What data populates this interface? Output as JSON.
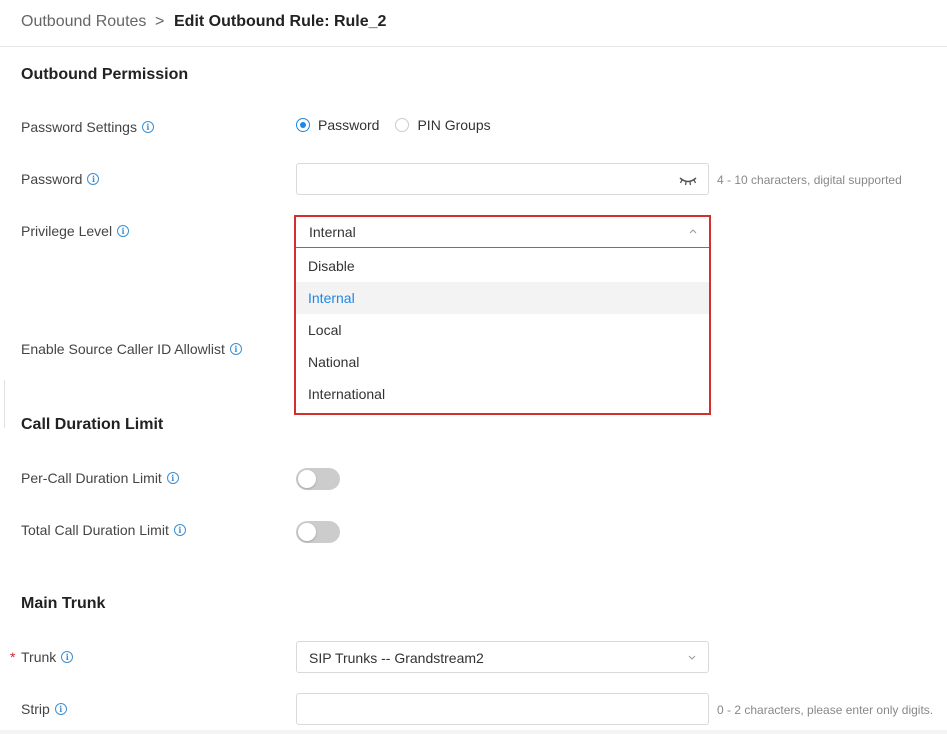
{
  "breadcrumb": {
    "parent": "Outbound Routes",
    "separator": ">",
    "current": "Edit Outbound Rule: Rule_2"
  },
  "sections": {
    "outbound_permission": "Outbound Permission",
    "call_duration_limit": "Call Duration Limit",
    "main_trunk": "Main Trunk"
  },
  "password_settings": {
    "label": "Password Settings",
    "options": [
      "Password",
      "PIN Groups"
    ],
    "selected": "Password"
  },
  "password": {
    "label": "Password",
    "value": "",
    "hint": "4 - 10 characters, digital supported"
  },
  "privilege_level": {
    "label": "Privilege Level",
    "selected": "Internal",
    "options": [
      "Disable",
      "Internal",
      "Local",
      "National",
      "International"
    ]
  },
  "source_caller_id": {
    "label": "Enable Source Caller ID Allowlist"
  },
  "per_call_duration": {
    "label": "Per-Call Duration Limit",
    "enabled": false
  },
  "total_call_duration": {
    "label": "Total Call Duration Limit",
    "enabled": false
  },
  "trunk": {
    "required_mark": "*",
    "label": "Trunk",
    "selected": "SIP Trunks -- Grandstream2"
  },
  "strip": {
    "label": "Strip",
    "value": "",
    "hint": "0 - 2 characters, please enter only digits."
  },
  "colors": {
    "accent": "#1e88e5",
    "highlight": "#d32f2f",
    "required": "#d9232e"
  },
  "icons": {
    "info": "info-icon",
    "eye": "eye-hidden-icon",
    "chevron_up": "chevron-up-icon",
    "chevron_down": "chevron-down-icon"
  }
}
